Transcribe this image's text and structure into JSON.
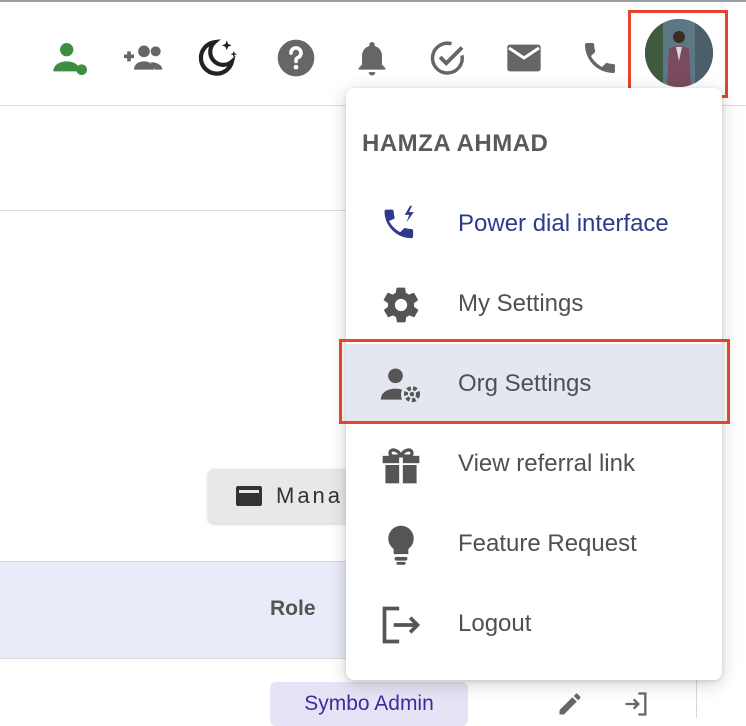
{
  "colors": {
    "accent": "#2e3a8c",
    "highlight": "#e2452b",
    "green": "#3e8e41",
    "icon_gray": "#6b6b6b"
  },
  "topbar": {
    "icons": [
      "user-status-icon",
      "add-team-icon",
      "dark-mode-icon",
      "help-icon",
      "bell-icon",
      "task-check-icon",
      "mail-icon",
      "phone-icon"
    ]
  },
  "background": {
    "manage_button_label": "Mana",
    "table": {
      "role_header": "Role"
    },
    "row": {
      "role_badge": "Symbo Admin"
    }
  },
  "menu": {
    "user_name": "HAMZA AHMAD",
    "items": [
      {
        "label": "Power dial interface",
        "icon": "power-dial-icon"
      },
      {
        "label": "My Settings",
        "icon": "gear-icon"
      },
      {
        "label": "Org Settings",
        "icon": "org-settings-icon"
      },
      {
        "label": "View referral link",
        "icon": "gift-icon"
      },
      {
        "label": "Feature Request",
        "icon": "lightbulb-icon"
      },
      {
        "label": "Logout",
        "icon": "logout-icon"
      }
    ]
  }
}
